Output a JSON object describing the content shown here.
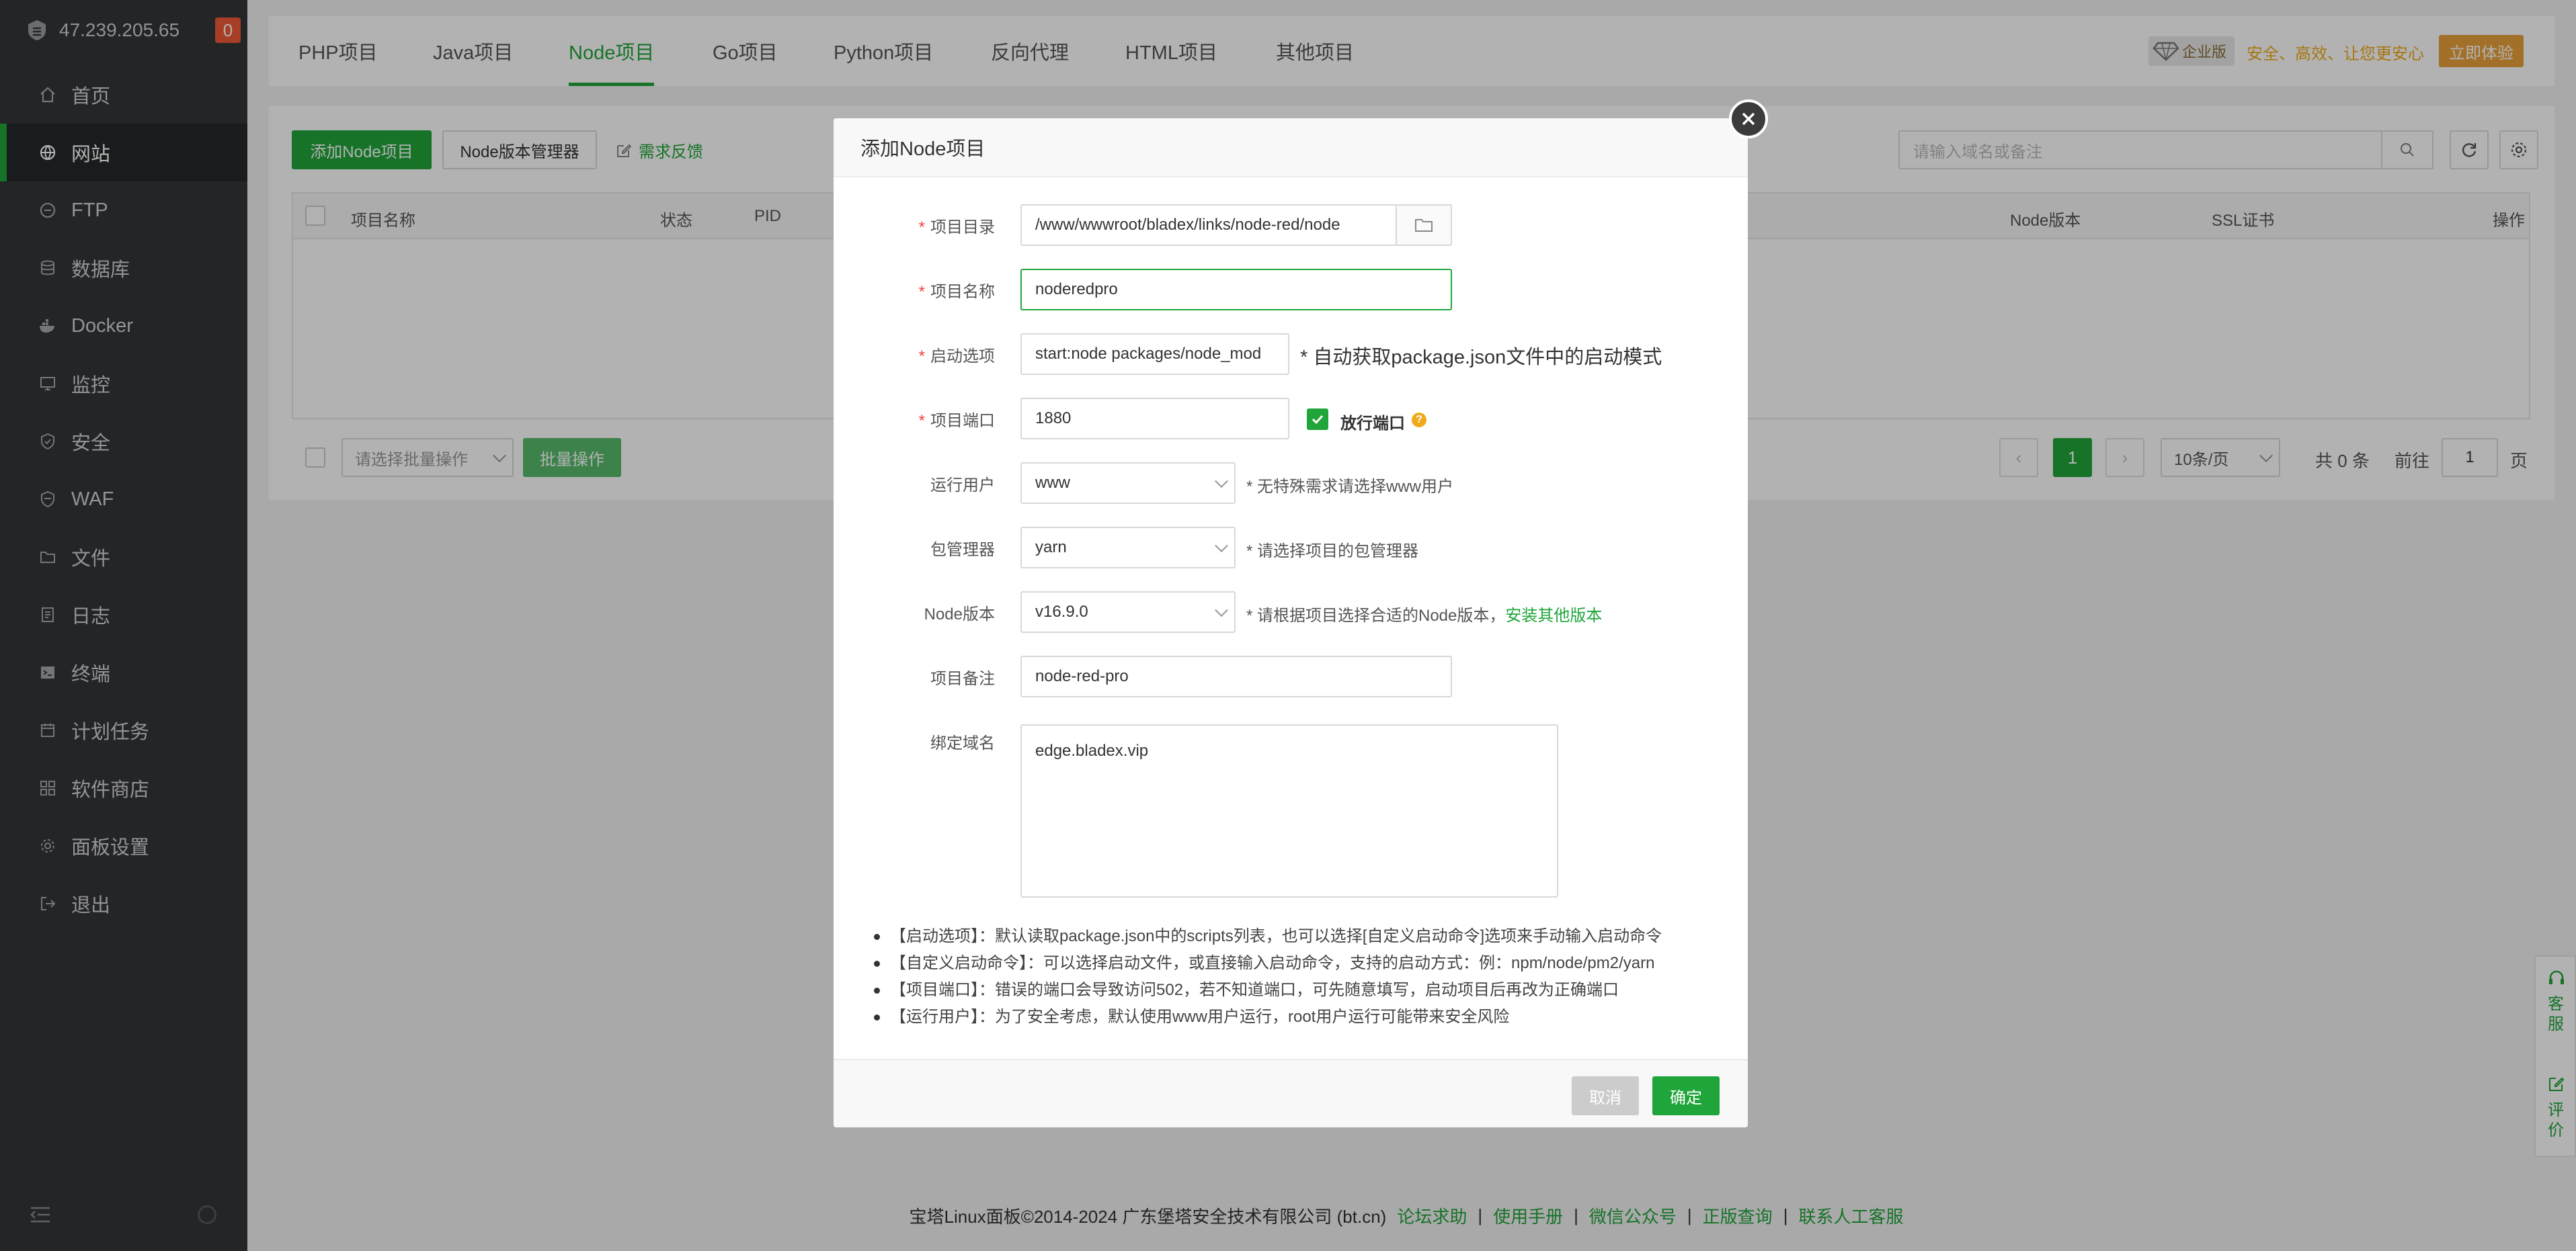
{
  "sidebar": {
    "ip": "47.239.205.65",
    "badge": "0",
    "items": [
      {
        "label": "首页",
        "icon": "home-icon"
      },
      {
        "label": "网站",
        "icon": "globe-icon"
      },
      {
        "label": "FTP",
        "icon": "ftp-icon"
      },
      {
        "label": "数据库",
        "icon": "database-icon"
      },
      {
        "label": "Docker",
        "icon": "docker-icon"
      },
      {
        "label": "监控",
        "icon": "monitor-icon"
      },
      {
        "label": "安全",
        "icon": "shield-icon"
      },
      {
        "label": "WAF",
        "icon": "waf-icon"
      },
      {
        "label": "文件",
        "icon": "folder-icon"
      },
      {
        "label": "日志",
        "icon": "log-icon"
      },
      {
        "label": "终端",
        "icon": "terminal-icon"
      },
      {
        "label": "计划任务",
        "icon": "schedule-icon"
      },
      {
        "label": "软件商店",
        "icon": "store-icon"
      },
      {
        "label": "面板设置",
        "icon": "settings-icon"
      },
      {
        "label": "退出",
        "icon": "logout-icon"
      }
    ],
    "active_index": 1
  },
  "tabs": [
    "PHP项目",
    "Java项目",
    "Node项目",
    "Go项目",
    "Python项目",
    "反向代理",
    "HTML项目",
    "其他项目"
  ],
  "active_tab": "Node项目",
  "enterprise": {
    "tag": "企业版",
    "slogan": "安全、高效、让您更安心",
    "try_label": "立即体验"
  },
  "toolbar": {
    "add_label": "添加Node项目",
    "version_mgr_label": "Node版本管理器",
    "feedback_label": "需求反馈",
    "search_placeholder": "请输入域名或备注"
  },
  "table": {
    "headers": [
      "项目名称",
      "状态",
      "PID",
      "Node版本",
      "SSL证书",
      "操作"
    ]
  },
  "batch": {
    "select_placeholder": "请选择批量操作",
    "button_label": "批量操作"
  },
  "pagination": {
    "current_page": "1",
    "page_size": "10条/页",
    "total_text": "共 0 条",
    "goto_label": "前往",
    "goto_value": "1",
    "page_label": "页"
  },
  "modal": {
    "title": "添加Node项目",
    "fields": {
      "dir_label": "项目目录",
      "dir_value": "/www/wwwroot/bladex/links/node-red/node",
      "name_label": "项目名称",
      "name_value": "noderedpro",
      "start_label": "启动选项",
      "start_value": "start:node packages/node_mod",
      "start_hint": "* 自动获取package.json文件中的启动模式",
      "port_label": "项目端口",
      "port_value": "1880",
      "open_port_label": "放行端口",
      "user_label": "运行用户",
      "user_value": "www",
      "user_hint": "* 无特殊需求请选择www用户",
      "pkg_label": "包管理器",
      "pkg_value": "yarn",
      "pkg_hint": "* 请选择项目的包管理器",
      "node_label": "Node版本",
      "node_value": "v16.9.0",
      "node_hint": "* 请根据项目选择合适的Node版本，",
      "node_link": "安装其他版本",
      "remark_label": "项目备注",
      "remark_value": "node-red-pro",
      "domain_label": "绑定域名",
      "domain_value": "edge.bladex.vip"
    },
    "notes": [
      "【启动选项】：默认读取package.json中的scripts列表，也可以选择[自定义启动命令]选项来手动输入启动命令",
      "【自定义启动命令】：可以选择启动文件，或直接输入启动命令，支持的启动方式：例：npm/node/pm2/yarn",
      "【项目端口】：错误的端口会导致访问502，若不知道端口，可先随意填写，启动项目后再改为正确端口",
      "【运行用户】：为了安全考虑，默认使用www用户运行，root用户运行可能带来安全风险"
    ],
    "cancel_label": "取消",
    "confirm_label": "确定"
  },
  "footer": {
    "copyright": "宝塔Linux面板©2014-2024 广东堡塔安全技术有限公司 (bt.cn)",
    "links": [
      "论坛求助",
      "使用手册",
      "微信公众号",
      "正版查询",
      "联系人工客服"
    ]
  },
  "side_service": {
    "service": "客服",
    "review": "评价"
  },
  "colors": {
    "brand_green": "#20a53a",
    "sidebar_bg": "#333538",
    "badge_red": "#ef5a35",
    "enterprise_orange": "#e8a13b"
  }
}
